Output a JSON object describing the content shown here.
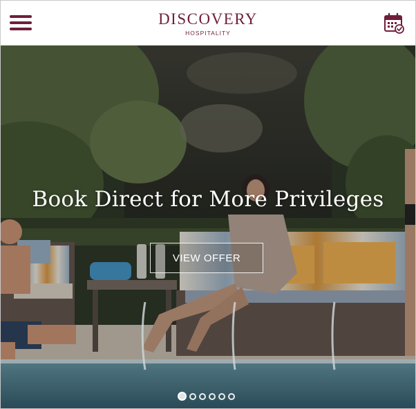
{
  "header": {
    "logo_main": "DISCOVERY",
    "logo_sub": "HOSPITALITY",
    "menu_icon": "hamburger-menu-icon",
    "booking_icon": "calendar-check-icon"
  },
  "hero": {
    "title": "Book Direct for More Privileges",
    "cta_label": "VIEW OFFER",
    "slides_total": 6,
    "active_slide": 1
  },
  "colors": {
    "brand": "#6e1f3a",
    "header_bg": "#ffffff",
    "overlay_text": "#ffffff"
  }
}
